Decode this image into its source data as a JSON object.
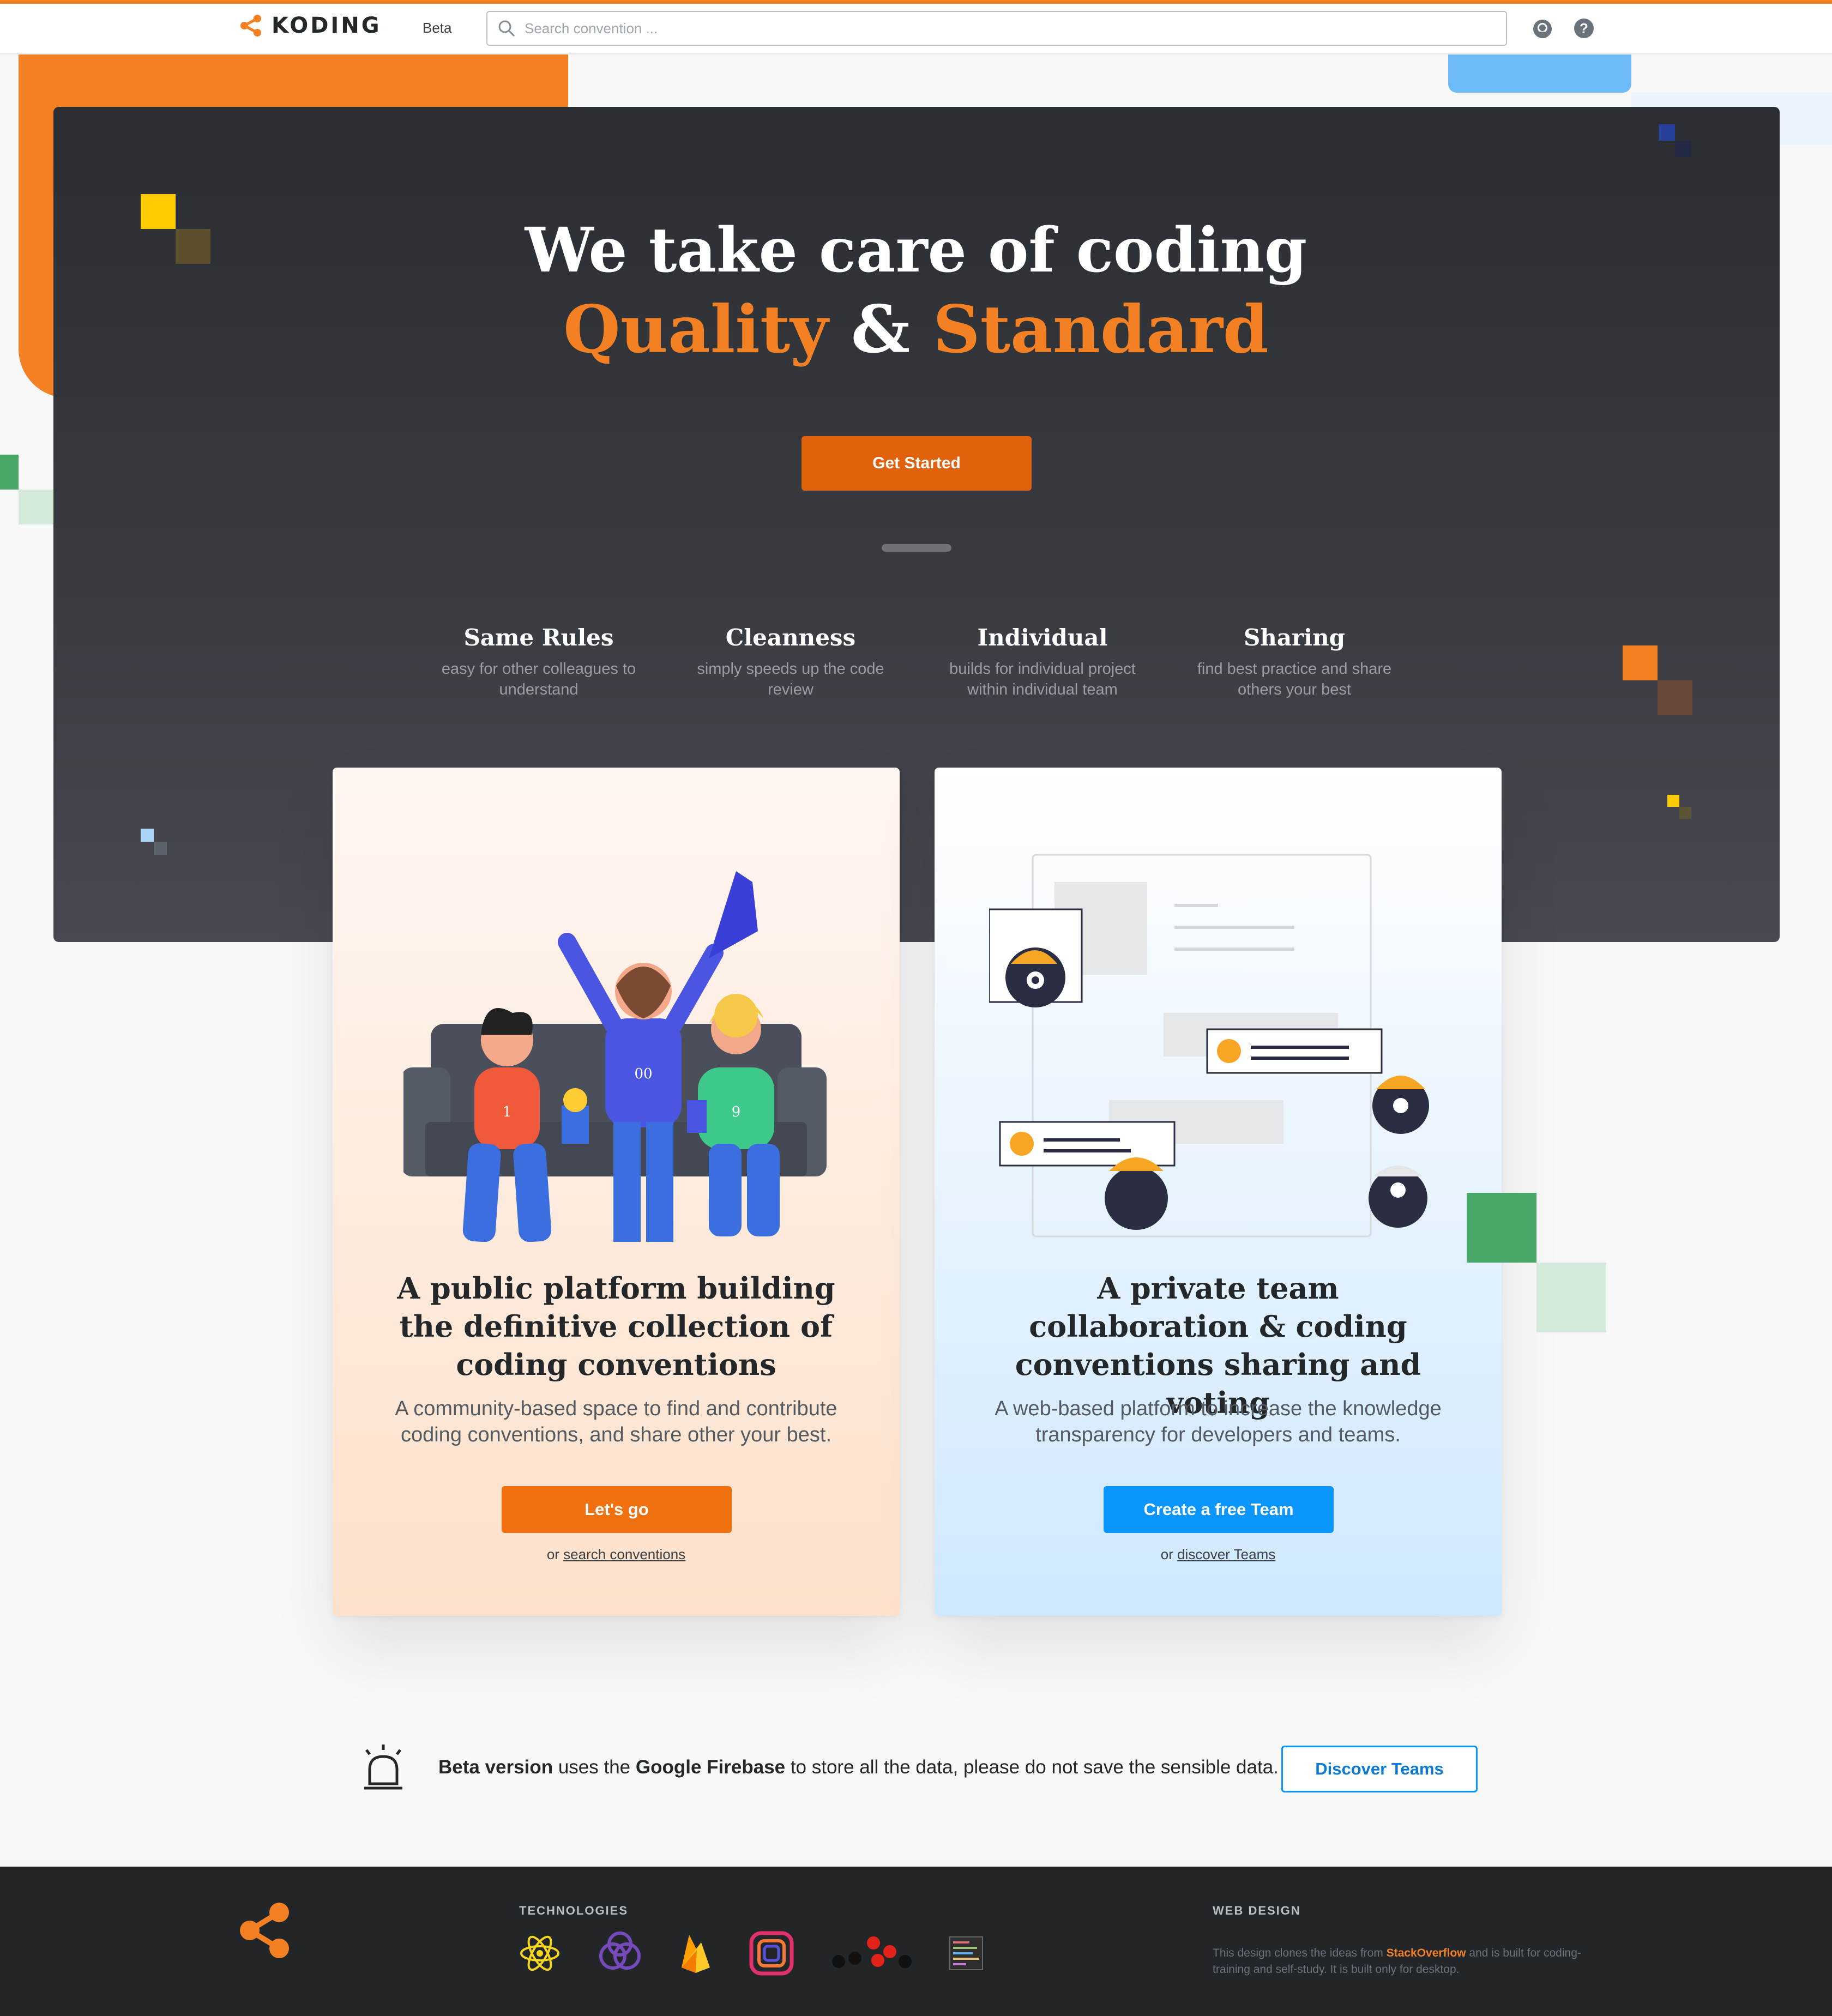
{
  "header": {
    "brand": "KODING",
    "beta_label": "Beta",
    "search_placeholder": "Search convention ...",
    "icons": [
      "github-icon",
      "help-icon"
    ]
  },
  "hero": {
    "title": "We take care of coding",
    "subtitle_part1": "Quality",
    "subtitle_and": " & ",
    "subtitle_part2": "Standard",
    "cta": "Get Started",
    "features": [
      {
        "title": "Same Rules",
        "desc": "easy for other colleagues to understand"
      },
      {
        "title": "Cleanness",
        "desc": "simply speeds up the code review"
      },
      {
        "title": "Individual",
        "desc": "builds for individual project within individual team"
      },
      {
        "title": "Sharing",
        "desc": "find best practice and share others your best"
      }
    ]
  },
  "cards": [
    {
      "title": "A public platform building the definitive collection of coding conventions",
      "desc": "A community-based space to find and contribute coding conventions, and share other your best.",
      "cta": "Let's go",
      "alt_prefix": "or ",
      "alt_link": "search conventions",
      "color": "#f48024"
    },
    {
      "title": "A private team collaboration & coding conventions sharing and voting",
      "desc": "A web-based platform to increase the knowledge transparency for developers and teams.",
      "cta": "Create a free Team",
      "alt_prefix": "or ",
      "alt_link": "discover Teams",
      "color": "#0a95ff"
    }
  ],
  "illustration_text": {
    "jersey1": "1",
    "jersey2": "00",
    "jersey3": "9"
  },
  "notice": {
    "bold1": "Beta version",
    "text1": " uses the ",
    "bold2": "Google Firebase",
    "text2": " to store all the data, please do not save the sensible data.",
    "button": "Discover Teams"
  },
  "footer": {
    "tech_heading": "TECHNOLOGIES",
    "tech_icons": [
      "react-icon",
      "redux-icon",
      "firebase-icon",
      "instagram-style-icon",
      "nodes-icon",
      "code-grid-icon"
    ],
    "design_heading": "WEB DESIGN",
    "design_text_1": "This design clones the ideas from ",
    "design_link": "StackOverflow",
    "design_text_2": " and is built for coding-training and self-study. It is built only for desktop."
  },
  "colors": {
    "accent": "#f48024",
    "blue": "#0a95ff",
    "dark": "#232629"
  }
}
